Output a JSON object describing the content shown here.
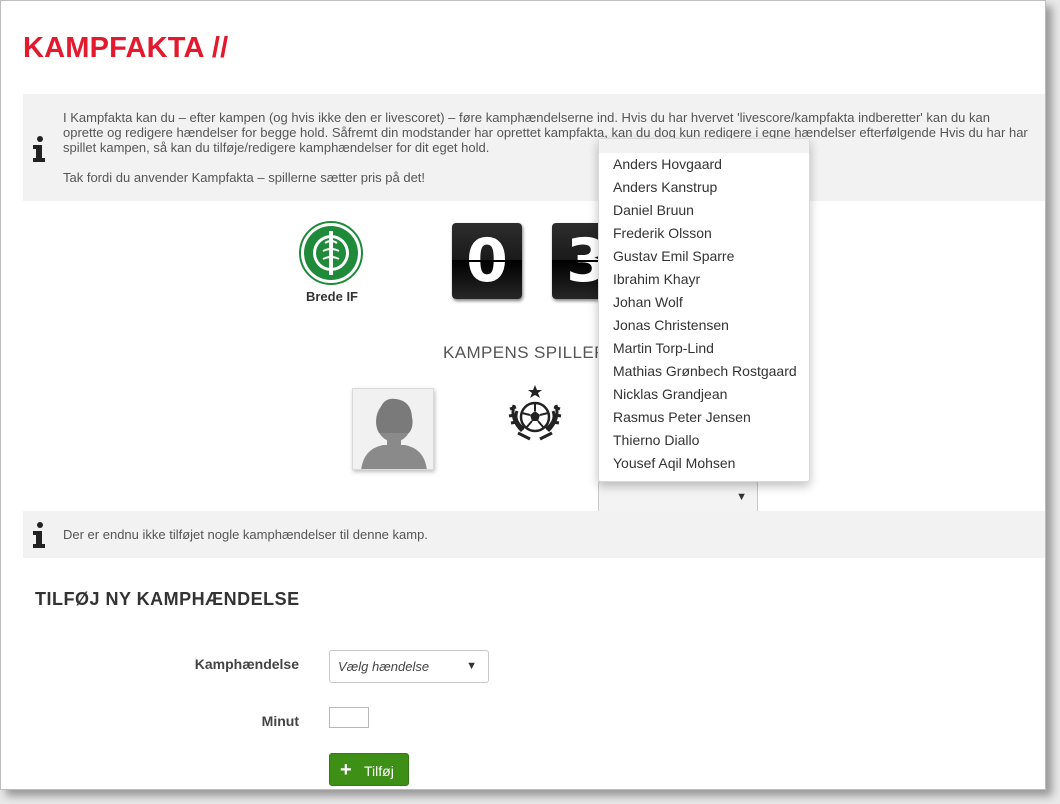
{
  "page": {
    "title": "KAMPFAKTA //"
  },
  "info": {
    "paragraph1": "I Kampfakta kan du – efter kampen (og hvis ikke den er livescoret) – føre kamphændelserne ind. Hvis du har hvervet 'livescore/kampfakta indberetter' kan du kan oprette og redigere hændelser for begge hold. Såfremt din modstander har oprettet kampfakta, kan du dog kun redigere i egne hændelser efterfølgende Hvis du har har spillet kampen, så kan du tilføje/redigere kamphændelser for dit eget hold.",
    "paragraph2": "Tak fordi du anvender Kampfakta – spillerne sætter pris på det!"
  },
  "match": {
    "home_team": "Brede IF",
    "home_score": "0",
    "away_score": "3"
  },
  "players_section": {
    "heading": "KAMPENS SPILLER"
  },
  "player_dropdown": {
    "options": [
      "Anders Hovgaard",
      "Anders Kanstrup",
      "Daniel Bruun",
      "Frederik Olsson",
      "Gustav Emil Sparre",
      "Ibrahim Khayr",
      "Johan Wolf",
      "Jonas Christensen",
      "Martin Torp-Lind",
      "Mathias Grønbech Rostgaard",
      "Nicklas Grandjean",
      "Rasmus Peter Jensen",
      "Thierno Diallo",
      "Yousef Aqil Mohsen"
    ],
    "caret": "▼"
  },
  "events_info": {
    "text": "Der er endnu ikke tilføjet nogle kamphændelser til denne kamp."
  },
  "add_event": {
    "title": "TILFØJ NY KAMPHÆNDELSE",
    "event_label": "Kamphændelse",
    "event_placeholder": "Vælg hændelse",
    "caret": "▼",
    "minute_label": "Minut",
    "minute_value": "",
    "submit_label": "Tilføj",
    "submit_icon": "+"
  },
  "colors": {
    "accent_red": "#e3192d",
    "button_green": "#3e8f16",
    "club_green": "#1f8a3a"
  }
}
